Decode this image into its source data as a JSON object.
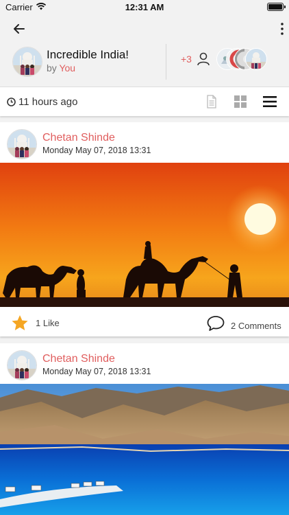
{
  "status": {
    "carrier": "Carrier",
    "time": "12:31 AM"
  },
  "album": {
    "title": "Incredible India!",
    "by_prefix": "by",
    "by_name": "You",
    "extra_members": "+3"
  },
  "toolbar": {
    "time_ago": "11 hours ago"
  },
  "posts": [
    {
      "author": "Chetan Shinde",
      "date": "Monday May 07, 2018 13:31",
      "likes": "1 Like",
      "comments": "2 Comments"
    },
    {
      "author": "Chetan Shinde",
      "date": "Monday May 07, 2018 13:31"
    }
  ],
  "icons": [
    "back-arrow-icon",
    "more-vertical-icon",
    "user-icon",
    "clock-icon",
    "document-view-icon",
    "grid-view-icon",
    "list-view-icon",
    "star-icon",
    "comment-icon"
  ],
  "colors": {
    "accent": "#e05d5d",
    "star": "#f5a623"
  }
}
